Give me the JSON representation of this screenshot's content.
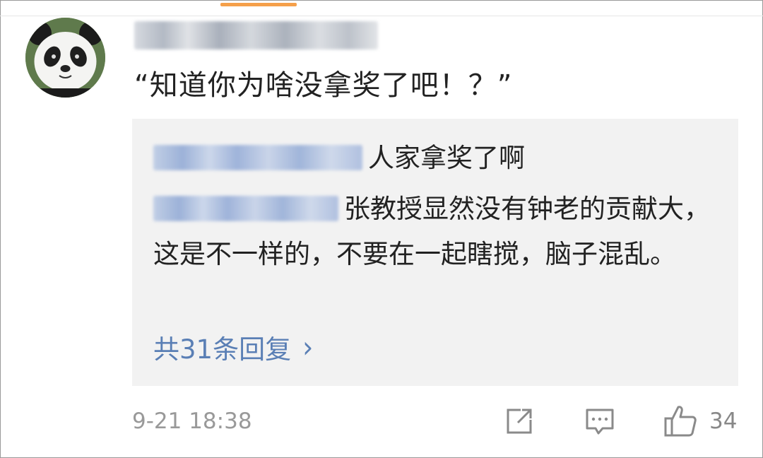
{
  "comment": {
    "text": "“知道你为啥没拿奖了吧！？”",
    "timestamp": "9-21 18:38",
    "like_count": "34"
  },
  "replies": [
    {
      "text": "人家拿奖了啊"
    },
    {
      "text": "张教授显然没有钟老的贡献大，这是不一样的，不要在一起瞎搅，脑子混乱。"
    }
  ],
  "more_replies_label": "共31条回复",
  "icons": {
    "avatar": "panda-avatar",
    "share": "share-icon",
    "reply": "comment-icon",
    "like": "thumbs-up-icon",
    "more": "chevron-right-icon"
  },
  "colors": {
    "link_blue": "#5a7fb5",
    "reply_bg": "#f2f2f2",
    "text": "#222222",
    "muted": "#999999"
  }
}
